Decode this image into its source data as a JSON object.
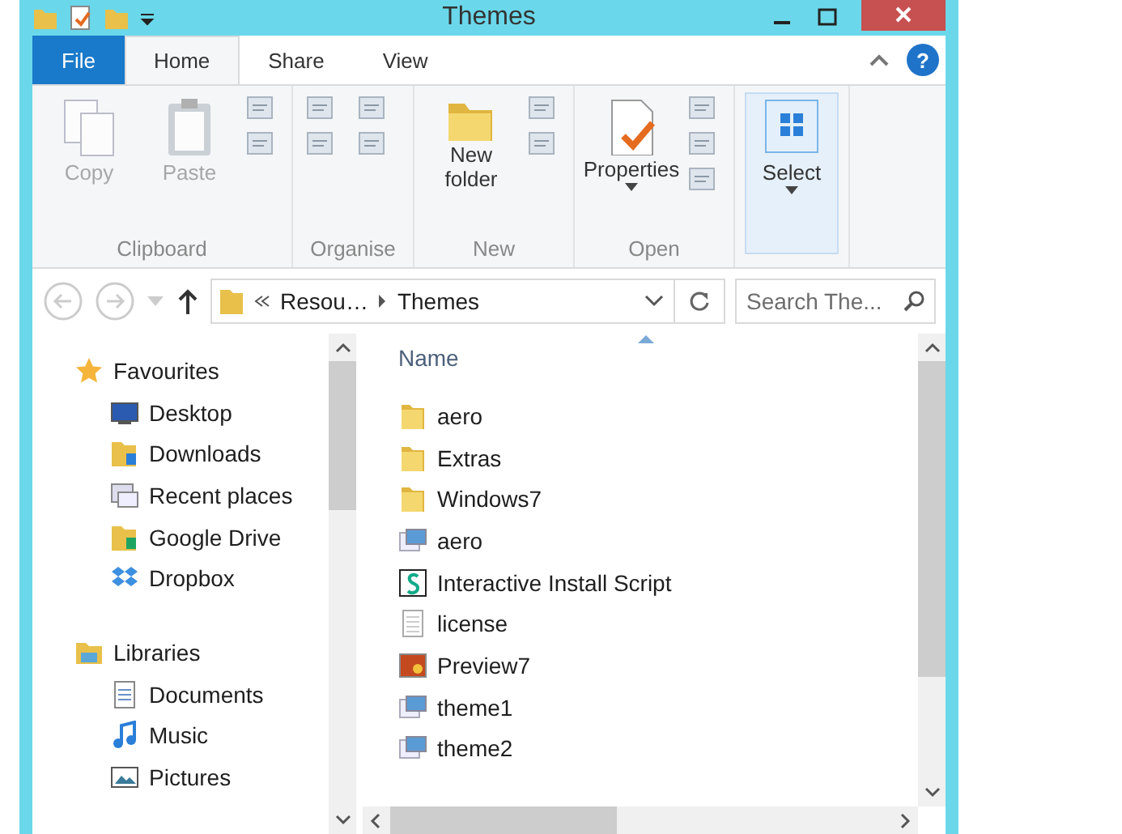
{
  "window": {
    "title": "Themes"
  },
  "tabs": [
    {
      "label": "File",
      "kind": "file",
      "selected": false
    },
    {
      "label": "Home",
      "kind": "tab",
      "selected": true
    },
    {
      "label": "Share",
      "kind": "tab",
      "selected": false
    },
    {
      "label": "View",
      "kind": "tab",
      "selected": false
    }
  ],
  "help": "?",
  "ribbon": {
    "groups": [
      {
        "label": "Clipboard",
        "buttons": [
          {
            "label": "Copy",
            "kind": "copy",
            "disabled": true
          },
          {
            "label": "Paste",
            "kind": "paste",
            "disabled": true
          }
        ]
      },
      {
        "label": "Organise"
      },
      {
        "label": "New",
        "buttons": [
          {
            "label": "New folder",
            "kind": "folder",
            "disabled": false
          }
        ]
      },
      {
        "label": "Open",
        "buttons": [
          {
            "label": "Properties",
            "kind": "properties",
            "disabled": false
          }
        ]
      },
      {
        "buttons": [
          {
            "label": "Select",
            "kind": "select",
            "disabled": false,
            "highlighted": true
          }
        ]
      }
    ]
  },
  "address": {
    "crumbs": [
      "Resou…",
      "Themes"
    ],
    "search_placeholder": "Search The..."
  },
  "nav": {
    "sections": [
      {
        "label": "Favourites",
        "kind": "star",
        "items": [
          {
            "label": "Desktop",
            "kind": "desktop"
          },
          {
            "label": "Downloads",
            "kind": "downloads"
          },
          {
            "label": "Recent places",
            "kind": "recent"
          },
          {
            "label": "Google Drive",
            "kind": "drive"
          },
          {
            "label": "Dropbox",
            "kind": "dropbox"
          }
        ]
      },
      {
        "label": "Libraries",
        "kind": "libraries",
        "items": [
          {
            "label": "Documents",
            "kind": "documents"
          },
          {
            "label": "Music",
            "kind": "music"
          },
          {
            "label": "Pictures",
            "kind": "pictures"
          }
        ]
      }
    ]
  },
  "files": {
    "column": "Name",
    "items": [
      {
        "name": "aero",
        "kind": "folder"
      },
      {
        "name": "Extras",
        "kind": "folder"
      },
      {
        "name": "Windows7",
        "kind": "folder"
      },
      {
        "name": "aero",
        "kind": "theme"
      },
      {
        "name": "Interactive Install Script",
        "kind": "script"
      },
      {
        "name": "license",
        "kind": "text"
      },
      {
        "name": "Preview7",
        "kind": "image"
      },
      {
        "name": "theme1",
        "kind": "theme"
      },
      {
        "name": "theme2",
        "kind": "theme"
      }
    ]
  }
}
